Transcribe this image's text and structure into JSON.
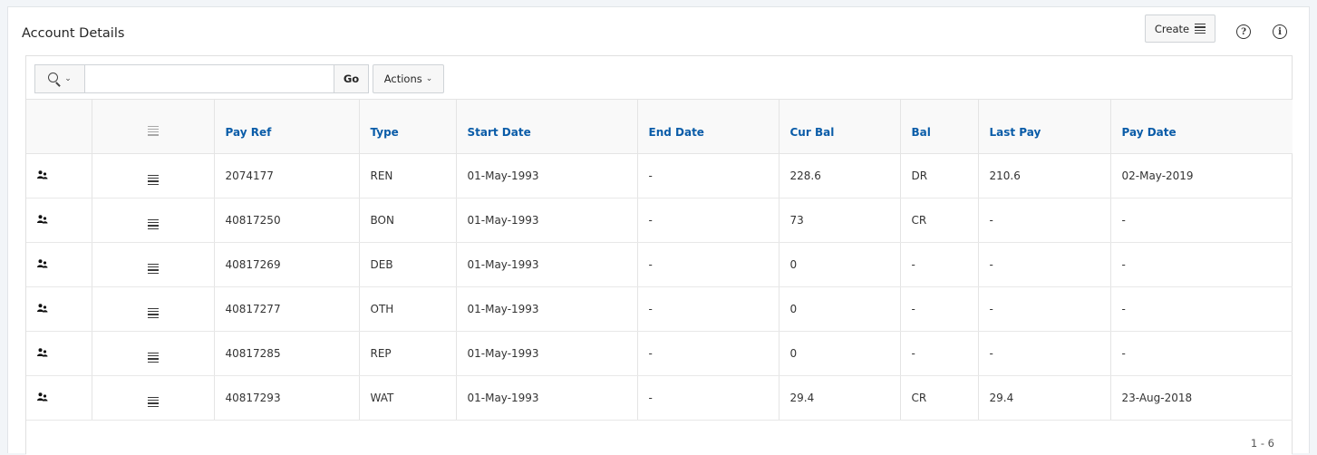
{
  "region": {
    "title": "Account Details",
    "create_label": "Create",
    "help_icon": "?",
    "info_icon": "i"
  },
  "toolbar": {
    "search_value": "",
    "search_placeholder": "",
    "go_label": "Go",
    "actions_label": "Actions"
  },
  "table": {
    "columns": [
      "",
      "",
      "Pay Ref",
      "Type",
      "Start Date",
      "End Date",
      "Cur Bal",
      "Bal",
      "Last Pay",
      "Pay Date"
    ],
    "rows": [
      [
        "2074177",
        "REN",
        "01-May-1993",
        "-",
        "228.6",
        "DR",
        "210.6",
        "02-May-2019"
      ],
      [
        "40817250",
        "BON",
        "01-May-1993",
        "-",
        "73",
        "CR",
        "-",
        "-"
      ],
      [
        "40817269",
        "DEB",
        "01-May-1993",
        "-",
        "0",
        "-",
        "-",
        "-"
      ],
      [
        "40817277",
        "OTH",
        "01-May-1993",
        "-",
        "0",
        "-",
        "-",
        "-"
      ],
      [
        "40817285",
        "REP",
        "01-May-1993",
        "-",
        "0",
        "-",
        "-",
        "-"
      ],
      [
        "40817293",
        "WAT",
        "01-May-1993",
        "-",
        "29.4",
        "CR",
        "29.4",
        "23-Aug-2018"
      ]
    ]
  },
  "pagination": "1 - 6",
  "colors": {
    "header_link": "#0a5ca8",
    "background": "#f2f5f8"
  },
  "icons": {
    "row_icon": "person-group-icon",
    "row_menu": "hamburger-menu-icon"
  }
}
